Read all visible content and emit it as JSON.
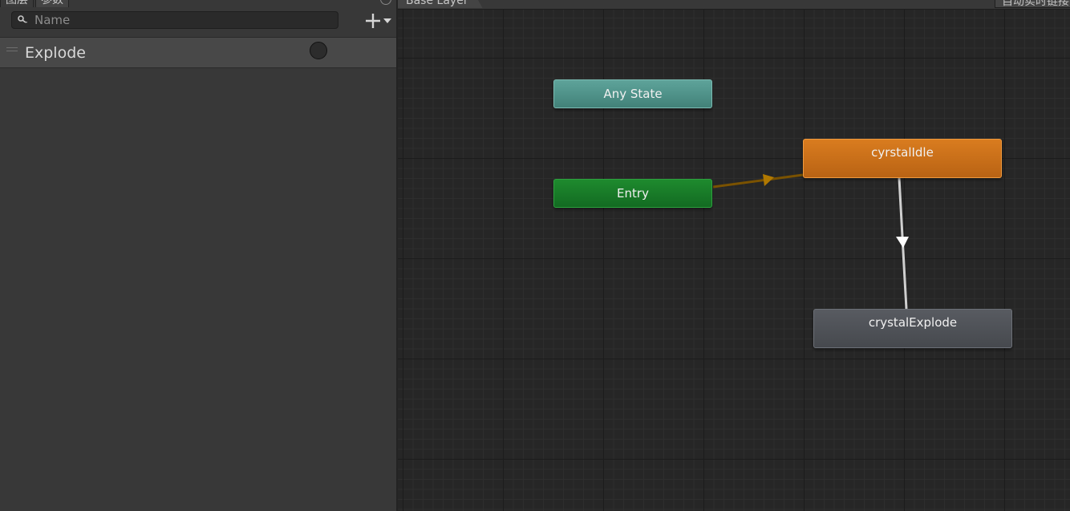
{
  "left_panel": {
    "tabs": [
      {
        "label": "图层"
      },
      {
        "label": "参数"
      }
    ],
    "search": {
      "placeholder": "Name",
      "value": ""
    },
    "add_button": {
      "icon": "plus-dropdown-icon"
    },
    "parameters": [
      {
        "name": "Explode",
        "type_icon": "trigger-radio-icon"
      }
    ]
  },
  "graph": {
    "breadcrumb": "Base Layer",
    "auto_live_label": "自动实时链接",
    "nodes": {
      "any_state": "Any State",
      "entry": "Entry",
      "cyrstal_idle": "cyrstalIdle",
      "crystal_explode": "crystalExplode"
    },
    "colors": {
      "any_state": "#4f9189",
      "entry": "#17792a",
      "default_state": "#c86d18",
      "state": "#505358",
      "entry_transition": "#7a5200",
      "state_transition": "#cfcfcf"
    }
  }
}
